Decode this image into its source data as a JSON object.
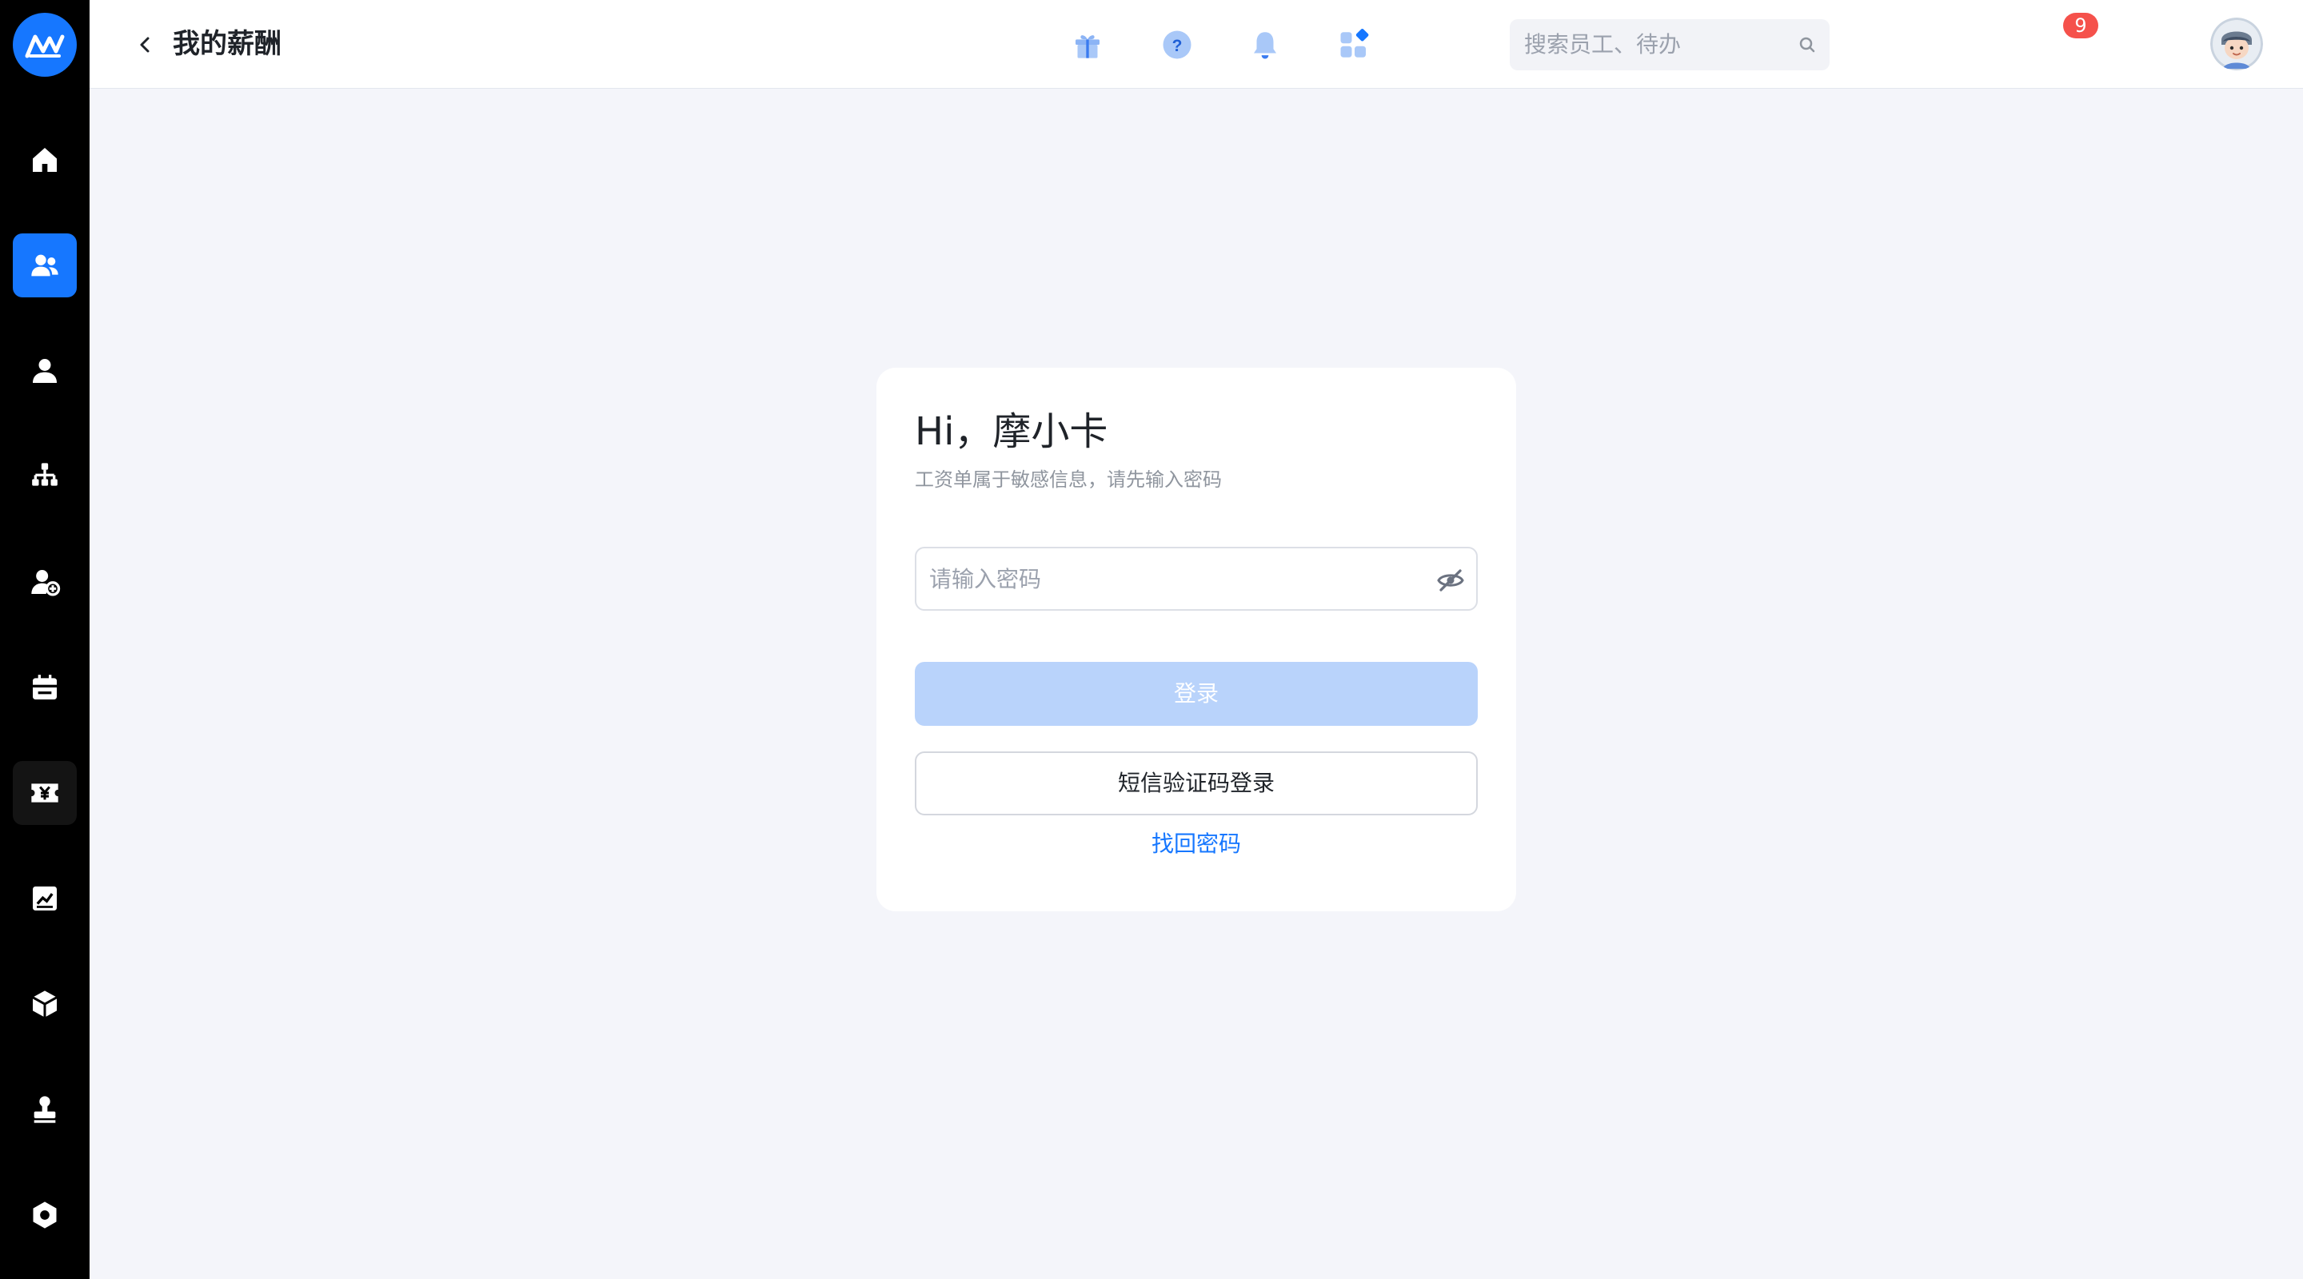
{
  "header": {
    "title": "我的薪酬",
    "search_placeholder": "搜索员工、待办",
    "notification_count": "9"
  },
  "sidebar": {
    "items": [
      {
        "icon": "home-icon"
      },
      {
        "icon": "team-icon",
        "active": true
      },
      {
        "icon": "person-icon"
      },
      {
        "icon": "org-chart-icon"
      },
      {
        "icon": "add-person-icon"
      },
      {
        "icon": "calendar-icon"
      },
      {
        "icon": "yen-ticket-icon"
      },
      {
        "icon": "chart-icon"
      },
      {
        "icon": "cube-icon"
      },
      {
        "icon": "stamp-icon"
      },
      {
        "icon": "settings-icon"
      }
    ]
  },
  "card": {
    "greeting": "Hi，摩小卡",
    "hint": "工资单属于敏感信息，请先输入密码",
    "password_placeholder": "请输入密码",
    "login_label": "登录",
    "sms_login_label": "短信验证码登录",
    "forgot_label": "找回密码"
  },
  "colors": {
    "accent": "#1677ff",
    "sidebar_bg": "#000000",
    "login_disabled": "#b9d3fb",
    "badge": "#f5514b"
  }
}
